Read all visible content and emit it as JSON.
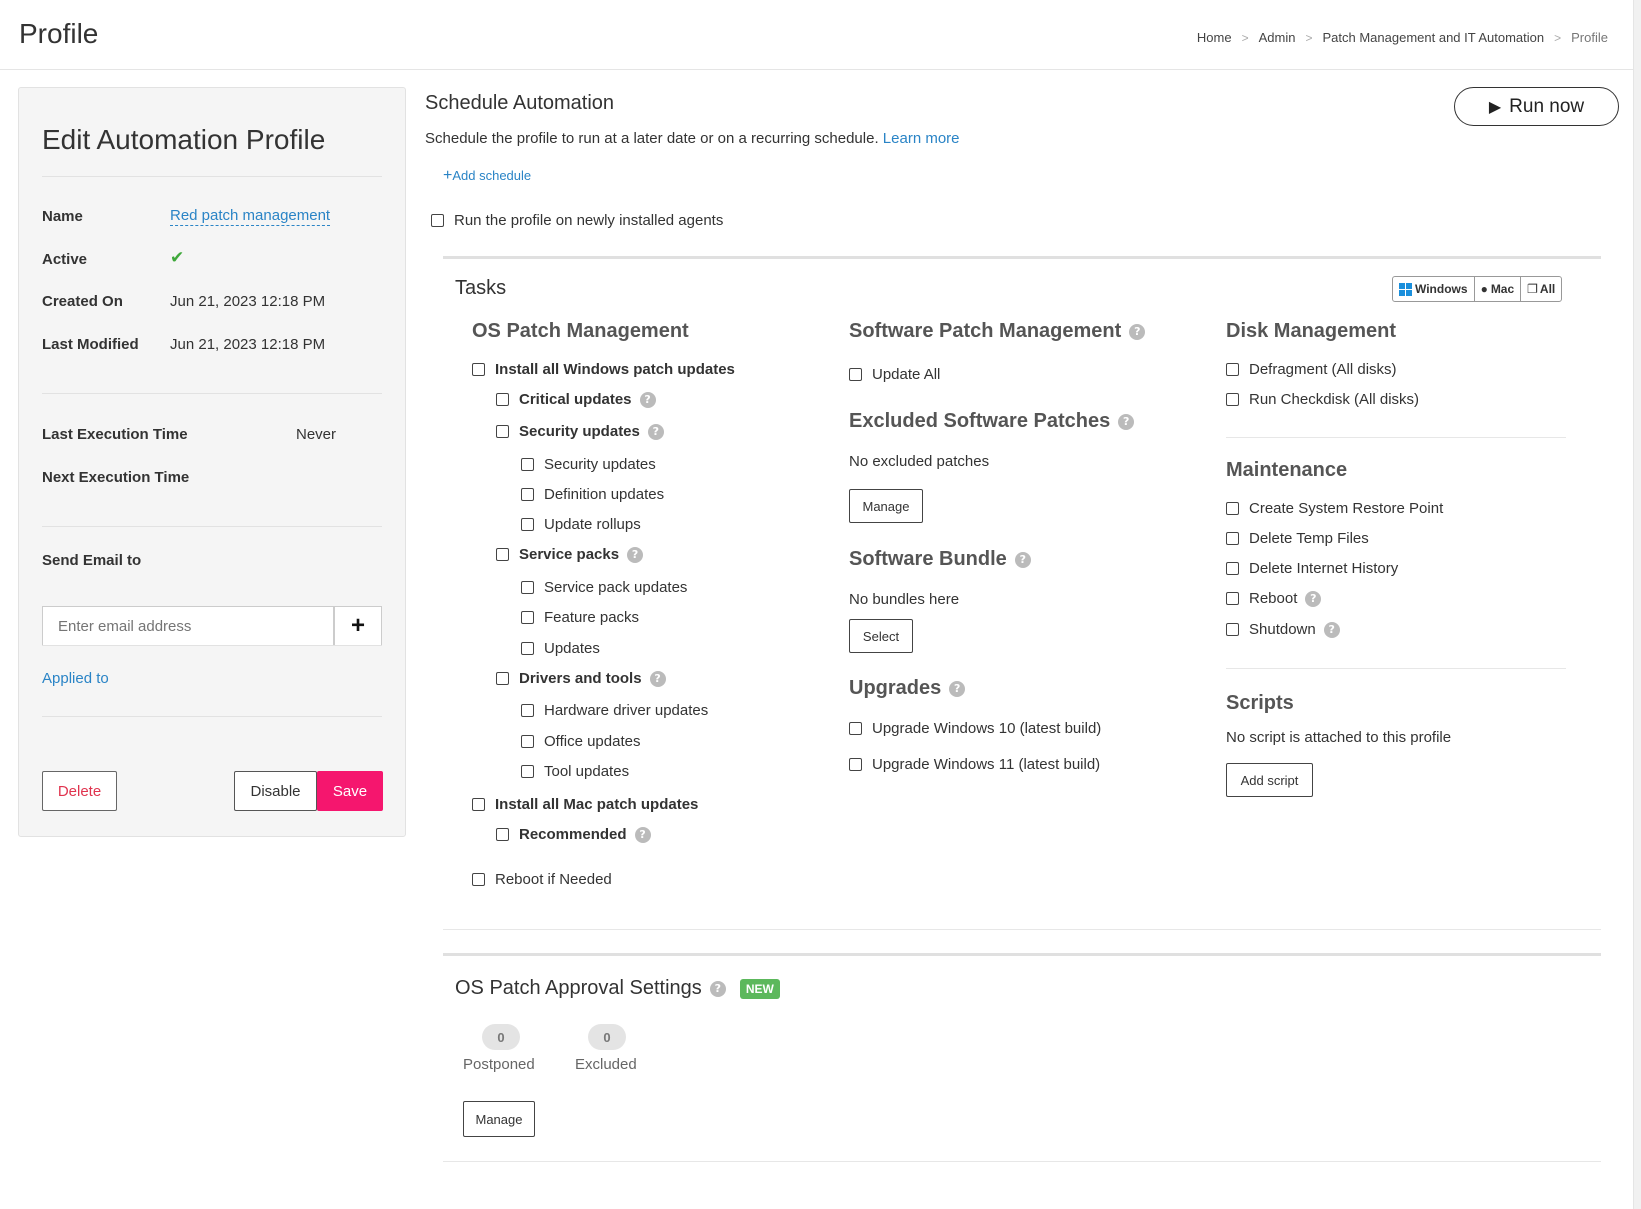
{
  "header": {
    "title": "Profile",
    "breadcrumb": [
      "Home",
      "Admin",
      "Patch Management and IT Automation",
      "Profile"
    ]
  },
  "left": {
    "title": "Edit Automation Profile",
    "name_label": "Name",
    "name_value": "Red patch management",
    "active_label": "Active",
    "created_label": "Created On",
    "created_value": "Jun 21, 2023 12:18 PM",
    "modified_label": "Last Modified",
    "modified_value": "Jun 21, 2023 12:18 PM",
    "last_exec_label": "Last Execution Time",
    "last_exec_value": "Never",
    "next_exec_label": "Next Execution Time",
    "email_label": "Send Email to",
    "email_placeholder": "Enter email address",
    "applied_to": "Applied to",
    "delete": "Delete",
    "disable": "Disable",
    "save": "Save"
  },
  "schedule": {
    "title": "Schedule Automation",
    "desc": "Schedule the profile to run at a later date or on a recurring schedule.",
    "learn_more": "Learn more",
    "add_schedule": "Add schedule",
    "run_new_agents": "Run the profile on newly installed agents",
    "run_now": "Run now"
  },
  "tasks": {
    "title": "Tasks",
    "os_filter": [
      "Windows",
      "Mac",
      "All"
    ],
    "os_patch": {
      "heading": "OS Patch Management",
      "install_windows": "Install all Windows patch updates",
      "critical": "Critical updates",
      "security": "Security updates",
      "security_items": [
        "Security updates",
        "Definition updates",
        "Update rollups"
      ],
      "service_packs": "Service packs",
      "service_items": [
        "Service pack updates",
        "Feature packs",
        "Updates"
      ],
      "drivers": "Drivers and tools",
      "driver_items": [
        "Hardware driver updates",
        "Office updates",
        "Tool updates"
      ],
      "install_mac": "Install all Mac patch updates",
      "recommended": "Recommended",
      "reboot": "Reboot if Needed"
    },
    "software_patch": {
      "heading": "Software Patch Management",
      "update_all": "Update All",
      "excluded_heading": "Excluded Software Patches",
      "no_excluded": "No excluded patches",
      "manage": "Manage",
      "bundle_heading": "Software Bundle",
      "no_bundles": "No bundles here",
      "select": "Select",
      "upgrades_heading": "Upgrades",
      "upgrade_win10": "Upgrade Windows 10 (latest build)",
      "upgrade_win11": "Upgrade Windows 11 (latest build)"
    },
    "disk": {
      "heading": "Disk Management",
      "defrag": "Defragment (All disks)",
      "checkdisk": "Run Checkdisk (All disks)"
    },
    "maintenance": {
      "heading": "Maintenance",
      "restore_point": "Create System Restore Point",
      "temp_files": "Delete Temp Files",
      "internet_history": "Delete Internet History",
      "reboot": "Reboot",
      "shutdown": "Shutdown"
    },
    "scripts": {
      "heading": "Scripts",
      "none": "No script is attached to this profile",
      "add": "Add script"
    }
  },
  "approval": {
    "title": "OS Patch Approval Settings",
    "badge": "NEW",
    "postponed_count": "0",
    "postponed_label": "Postponed",
    "excluded_count": "0",
    "excluded_label": "Excluded",
    "manage": "Manage"
  },
  "colors": {
    "link": "#2a84c6",
    "save": "#f5166e",
    "delete_text": "#e0334e",
    "active_check": "#3ea83a",
    "new_badge": "#5cb85c"
  }
}
